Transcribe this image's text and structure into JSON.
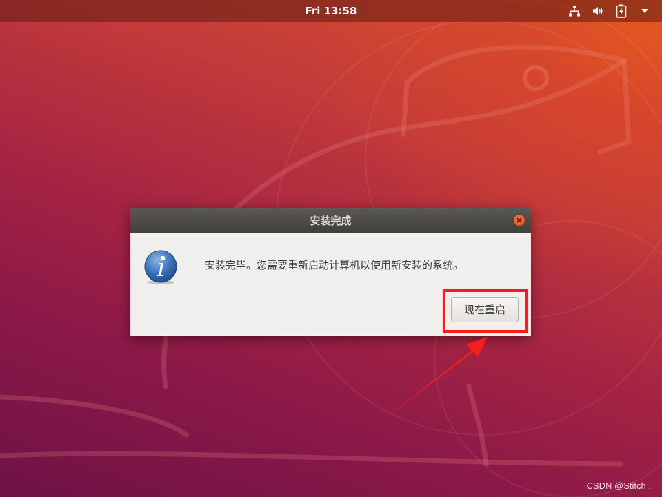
{
  "top_bar": {
    "clock": "Fri 13:58",
    "tray_icons": [
      "network-icon",
      "volume-icon",
      "battery-icon",
      "chevron-down-icon"
    ]
  },
  "dialog": {
    "title": "安装完成",
    "icon": "info-icon",
    "message": "安装完毕。您需要重新启动计算机以使用新安装的系统。",
    "restart_button": "现在重启"
  },
  "annotation": {
    "highlight_color": "#f51d1d"
  },
  "watermark": "CSDN @Stitch ."
}
